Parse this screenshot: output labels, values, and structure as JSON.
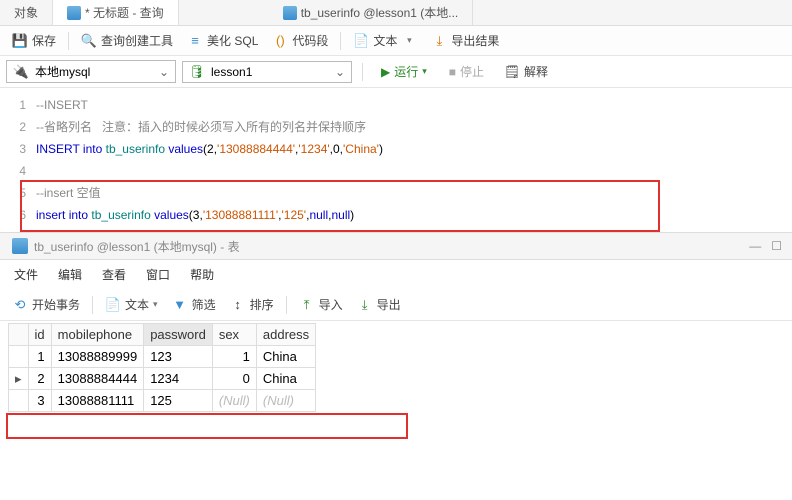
{
  "topTabs": {
    "objects": "对象",
    "query": "* 无标题 - 查询",
    "table": "tb_userinfo @lesson1 (本地..."
  },
  "toolbar": {
    "save": "保存",
    "queryBuilder": "查询创建工具",
    "beautify": "美化 SQL",
    "snippet": "代码段",
    "text": "文本",
    "export": "导出结果"
  },
  "conn": {
    "db": "本地mysql",
    "schema": "lesson1",
    "run": "运行",
    "stop": "停止",
    "explain": "解释"
  },
  "code": {
    "l1": "--INSERT",
    "l2a": "--省略列名   注意：插入的时候必须写入所有的列名并保持顺序",
    "l3_kw1": "INSERT",
    "l3_kw2": "into",
    "l3_nm": "tb_userinfo",
    "l3_kw3": "values",
    "l3_p": "(2,",
    "l3_s1": "'13088884444'",
    "l3_c1": ",",
    "l3_s2": "'1234'",
    "l3_c2": ",0,",
    "l3_s3": "'China'",
    "l3_e": ")",
    "l5": "--insert 空值",
    "l6_kw1": "insert",
    "l6_kw2": "into",
    "l6_nm": "tb_userinfo",
    "l6_kw3": "values",
    "l6_p": "(3,",
    "l6_s1": "'13088881111'",
    "l6_c1": ",",
    "l6_s2": "'125'",
    "l6_c2": ",",
    "l6_n1": "null",
    "l6_c3": ",",
    "l6_n2": "null",
    "l6_e": ")"
  },
  "panel": {
    "title": "tb_userinfo @lesson1 (本地mysql) - 表"
  },
  "menu": {
    "file": "文件",
    "edit": "编辑",
    "view": "查看",
    "window": "窗口",
    "help": "帮助"
  },
  "toolbar2": {
    "begin": "开始事务",
    "text": "文本",
    "filter": "筛选",
    "sort": "排序",
    "import": "导入",
    "export": "导出"
  },
  "cols": {
    "id": "id",
    "mobile": "mobilephone",
    "pwd": "password",
    "sex": "sex",
    "addr": "address"
  },
  "rows": [
    {
      "id": "1",
      "mobile": "13088889999",
      "pwd": "123",
      "sex": "1",
      "addr": "China"
    },
    {
      "id": "2",
      "mobile": "13088884444",
      "pwd": "1234",
      "sex": "0",
      "addr": "China"
    },
    {
      "id": "3",
      "mobile": "13088881111",
      "pwd": "125",
      "sex": "(Null)",
      "addr": "(Null)"
    }
  ]
}
